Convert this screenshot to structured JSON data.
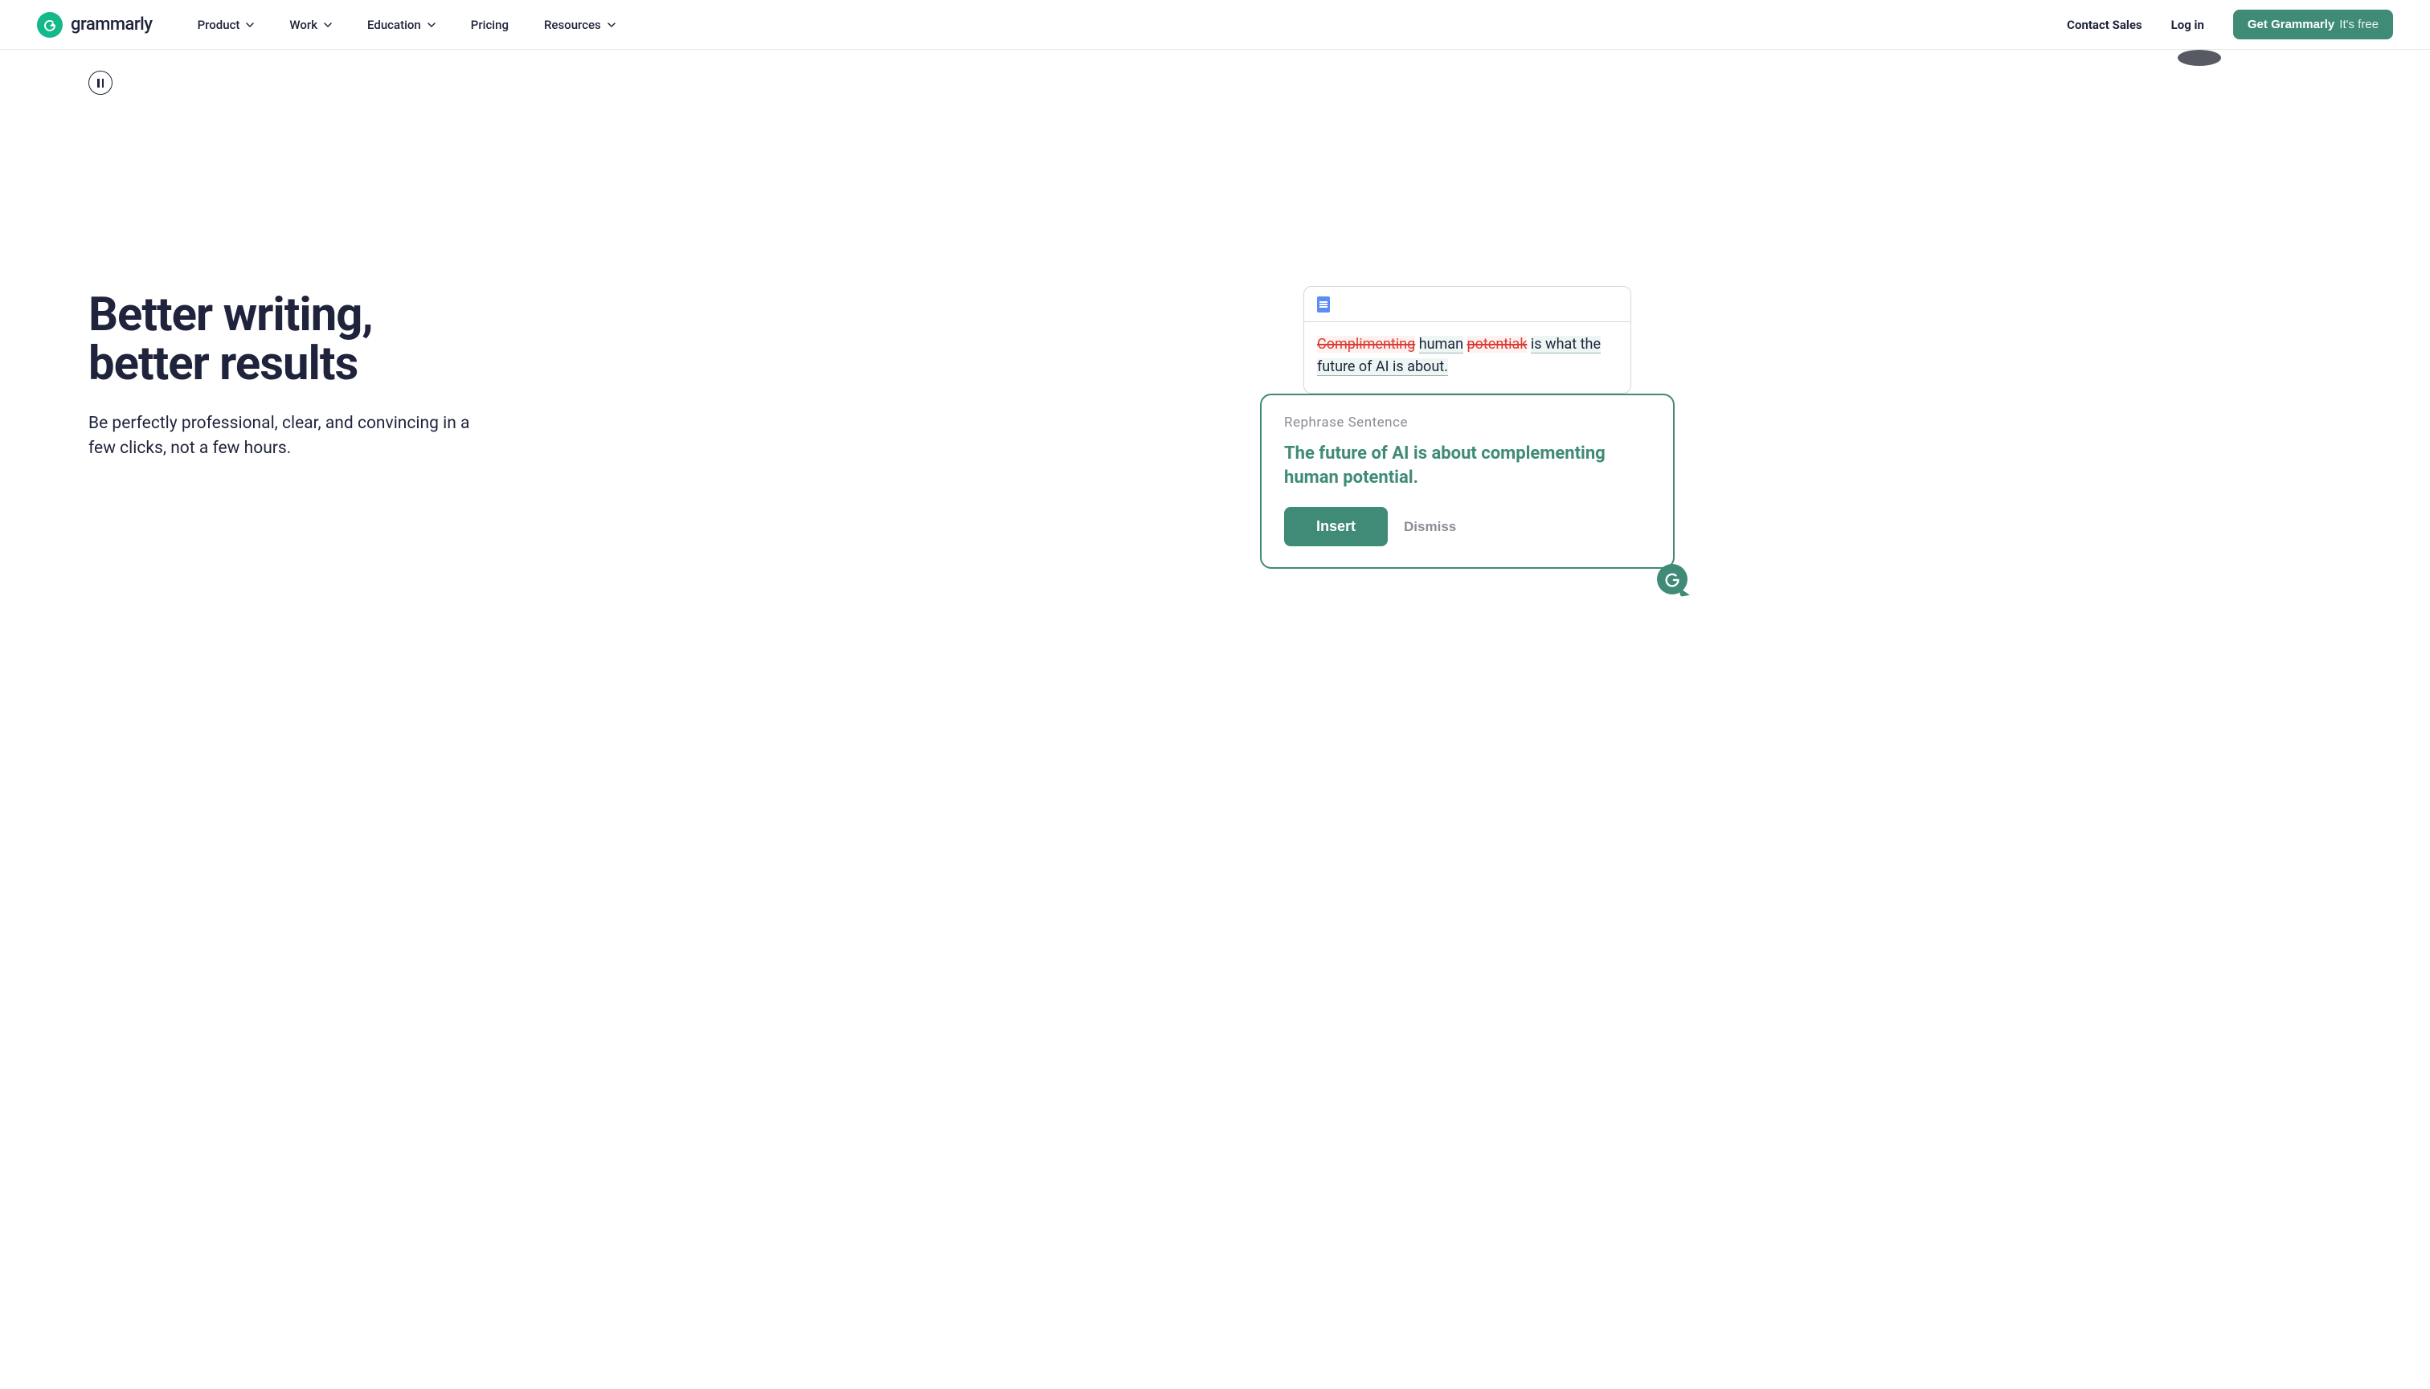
{
  "brand": {
    "wordmark": "grammarly"
  },
  "nav": {
    "items": [
      {
        "label": "Product",
        "has_menu": true
      },
      {
        "label": "Work",
        "has_menu": true
      },
      {
        "label": "Education",
        "has_menu": true
      },
      {
        "label": "Pricing",
        "has_menu": false
      },
      {
        "label": "Resources",
        "has_menu": true
      }
    ],
    "contact_sales": "Contact Sales",
    "login": "Log in",
    "cta_main": "Get Grammarly",
    "cta_sub": "It's free"
  },
  "hero": {
    "title": "Better writing,\nbetter results",
    "subtitle": "Be perfectly professional, clear, and convincing in a few clicks, not a few hours."
  },
  "doc": {
    "text_struck_1": "Complimenting",
    "text_plain_1": " ",
    "text_hl_1": "human",
    "text_plain_2": " ",
    "text_struck_2": "potentiak",
    "text_plain_3": " ",
    "text_hl_2": "is what the future of AI is about."
  },
  "suggestion": {
    "label": "Rephrase Sentence",
    "text": "The future of AI is about complementing human potential.",
    "insert": "Insert",
    "dismiss": "Dismiss"
  },
  "colors": {
    "brand_green": "#15b88a",
    "accent_green": "#3f8b78",
    "error_red": "#da3b34",
    "ink": "#1f243c"
  }
}
